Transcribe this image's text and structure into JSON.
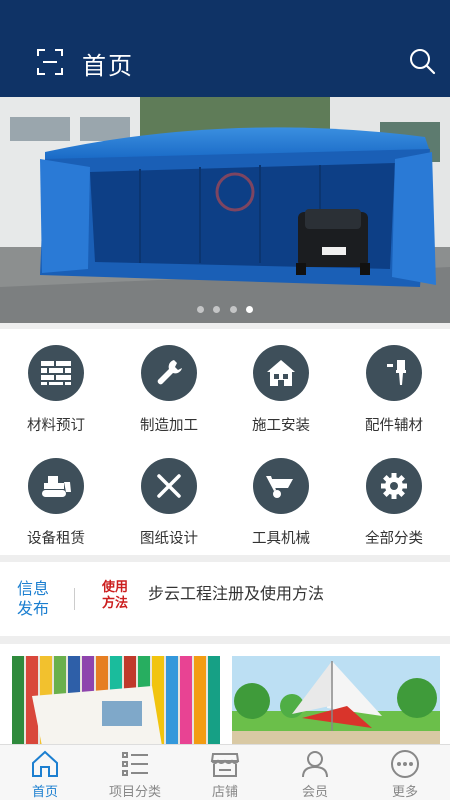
{
  "colors": {
    "header_bg": "#0f3366",
    "accent": "#1c7fd0",
    "icon_circle": "#3e4f5a",
    "news_badge": "#cc1f1f"
  },
  "header": {
    "title": "首页",
    "left_icon": "scan-icon",
    "right_icon": "search-icon"
  },
  "banner": {
    "slides": 4,
    "active_slide": 4,
    "content": "blue retractable tent canopy photo"
  },
  "categories": [
    {
      "label": "材料预订",
      "icon": "brick-wall-icon"
    },
    {
      "label": "制造加工",
      "icon": "wrench-icon"
    },
    {
      "label": "施工安装",
      "icon": "house-icon"
    },
    {
      "label": "配件辅材",
      "icon": "paintbrush-icon"
    },
    {
      "label": "设备租赁",
      "icon": "bulldozer-icon"
    },
    {
      "label": "图纸设计",
      "icon": "drafting-tools-icon"
    },
    {
      "label": "工具机械",
      "icon": "wheelbarrow-icon"
    },
    {
      "label": "全部分类",
      "icon": "gear-icon"
    }
  ],
  "news": {
    "tag": "信息发布",
    "badge": "使用方法",
    "title": "步云工程注册及使用方法"
  },
  "products": [
    {
      "content": "colorful fabric rolls and catalog photo"
    },
    {
      "content": "membrane structure shade sails in park photo"
    }
  ],
  "tabbar": [
    {
      "label": "首页",
      "icon": "home-icon",
      "active": true
    },
    {
      "label": "项目分类",
      "icon": "list-icon",
      "active": false
    },
    {
      "label": "店铺",
      "icon": "store-icon",
      "active": false
    },
    {
      "label": "会员",
      "icon": "user-icon",
      "active": false
    },
    {
      "label": "更多",
      "icon": "more-icon",
      "active": false
    }
  ]
}
